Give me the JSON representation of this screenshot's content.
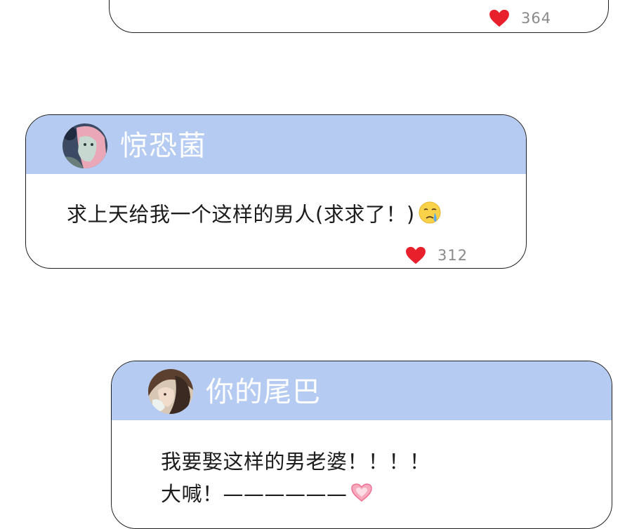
{
  "comments": [
    {
      "username": "",
      "text": "",
      "likes": "364",
      "like_icon": "heart-icon"
    },
    {
      "username": "惊恐菌",
      "text": "求上天给我一个这样的男人(求求了！)",
      "emoji": "crying-face-emoji",
      "likes": "312",
      "like_icon": "heart-icon"
    },
    {
      "username": "你的尾巴",
      "text_lines": [
        "我要娶这样的男老婆！！！！",
        "大喊！——————"
      ],
      "emoji": "heart-emoji",
      "likes": "",
      "like_icon": "heart-icon"
    }
  ],
  "colors": {
    "header_bg": "#b5cbf2",
    "card_border": "#1f1f1f",
    "like_heart": "#e8202c",
    "like_count": "#8a8a8a",
    "username_text": "#ffffff"
  }
}
